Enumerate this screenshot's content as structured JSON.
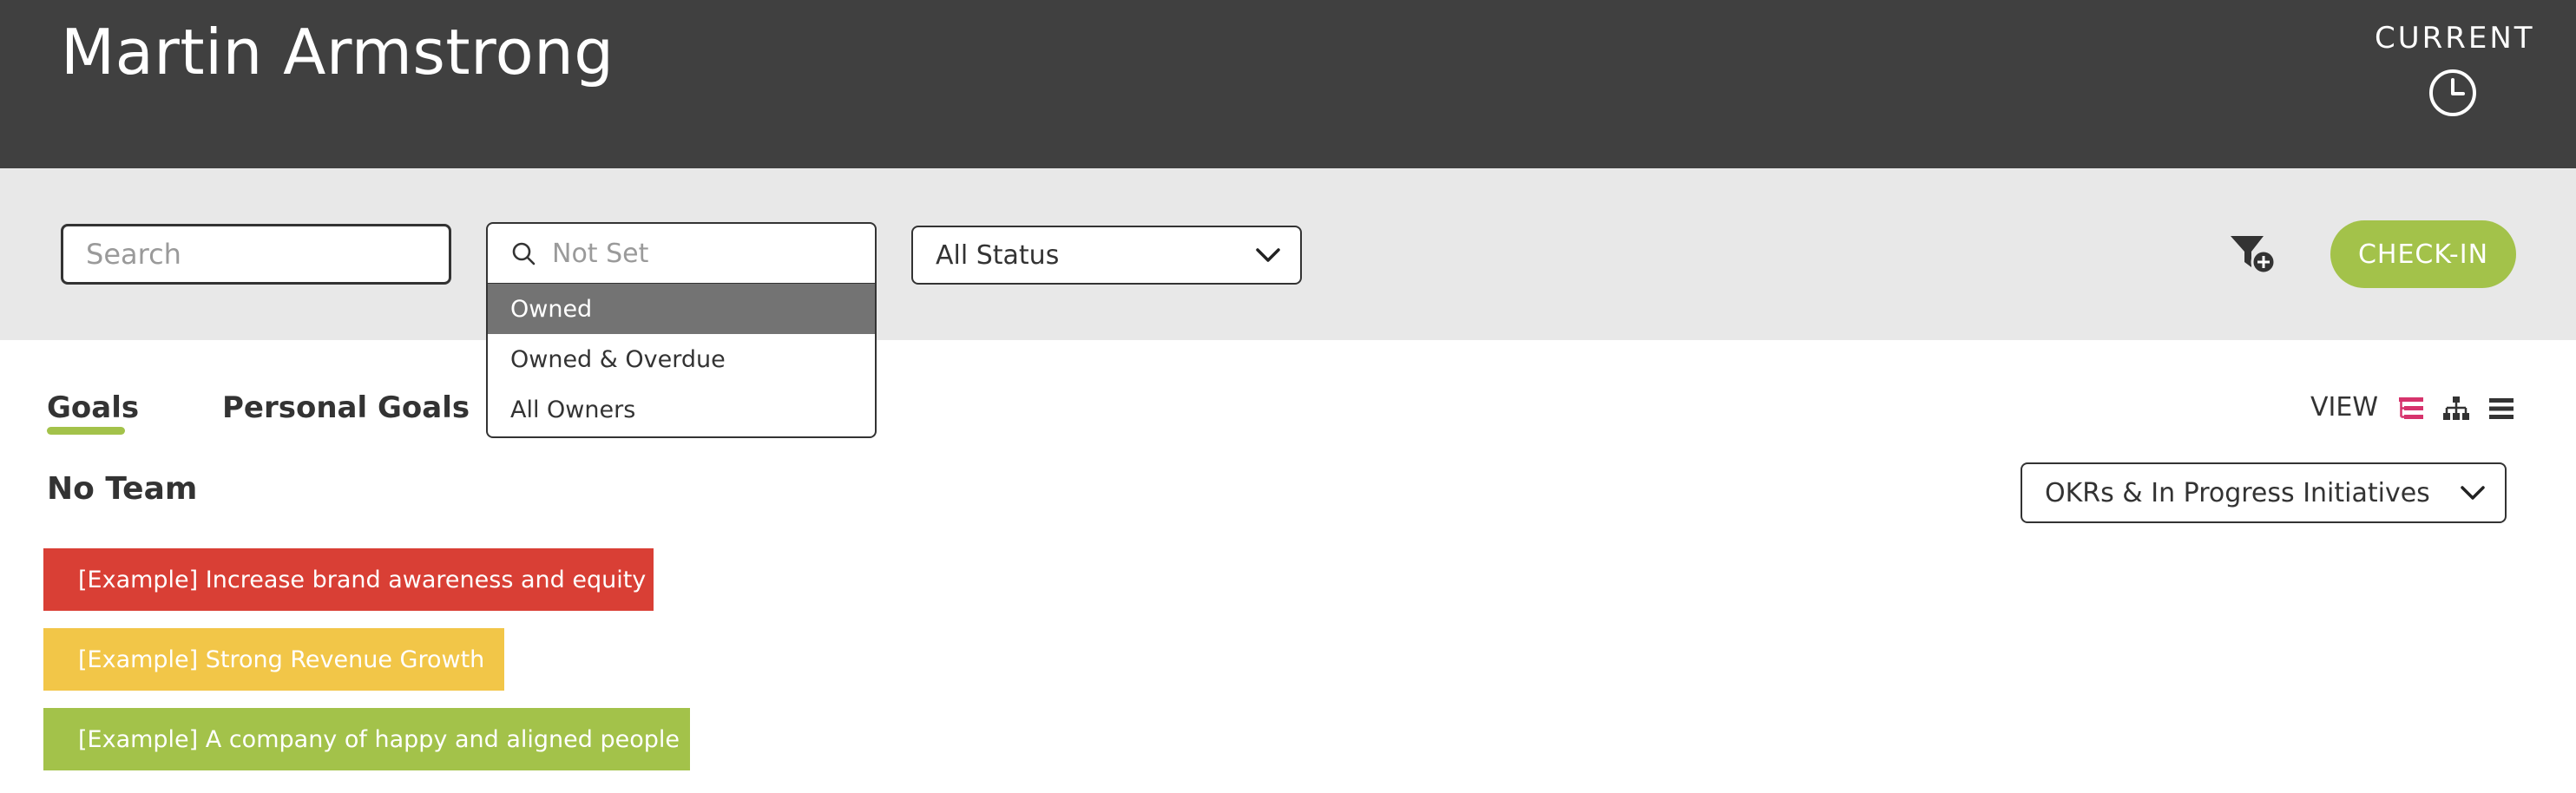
{
  "header": {
    "name": "Martin Armstrong",
    "current_label": "CURRENT"
  },
  "filters": {
    "search_placeholder": "Search",
    "owner_placeholder": "Not Set",
    "status_value": "All Status",
    "checkin_label": "CHECK-IN"
  },
  "owner_dropdown": {
    "items": [
      {
        "label": "Owned",
        "active": true
      },
      {
        "label": "Owned & Overdue",
        "active": false
      },
      {
        "label": "All Owners",
        "active": false
      }
    ]
  },
  "tabs": [
    {
      "label": "Goals",
      "active": true
    },
    {
      "label": "Personal Goals",
      "active": false
    }
  ],
  "view": {
    "label": "VIEW",
    "icons": [
      "tree-view-icon",
      "hierarchy-view-icon",
      "list-view-icon"
    ],
    "active_icon": "tree-view-icon",
    "select_value": "OKRs & In Progress Initiatives"
  },
  "team": {
    "title": "No Team"
  },
  "goals": [
    {
      "label": "[Example] Increase brand awareness and equity",
      "color": "#d93f35"
    },
    {
      "label": "[Example] Strong Revenue Growth",
      "color": "#f2c648"
    },
    {
      "label": "[Example] A company of happy and aligned people",
      "color": "#a3c24a"
    }
  ],
  "colors": {
    "header_bg": "#404040",
    "filterbar_bg": "#e8e8e8",
    "accent_green": "#a3c24a",
    "accent_pink": "#d6336c",
    "dropdown_active": "#737373"
  }
}
